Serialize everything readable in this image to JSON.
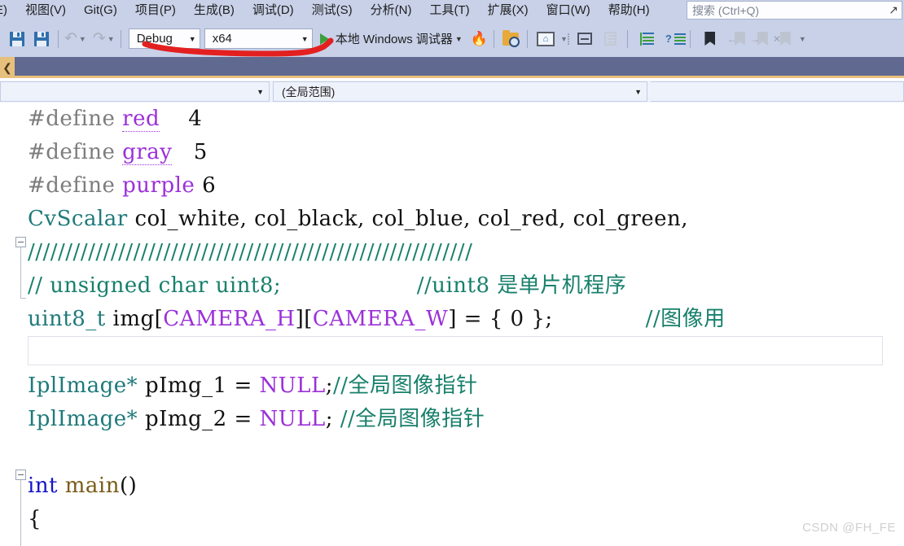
{
  "app": {
    "theme_accent": "#c8d1e8",
    "tabstrip_color": "#60698f",
    "tab_accent": "#e8c07d"
  },
  "menubar": {
    "items": [
      {
        "label": "E)",
        "name": "menu-edit-partial"
      },
      {
        "label": "视图(V)",
        "name": "menu-view"
      },
      {
        "label": "Git(G)",
        "name": "menu-git"
      },
      {
        "label": "项目(P)",
        "name": "menu-project"
      },
      {
        "label": "生成(B)",
        "name": "menu-build"
      },
      {
        "label": "调试(D)",
        "name": "menu-debug"
      },
      {
        "label": "测试(S)",
        "name": "menu-test"
      },
      {
        "label": "分析(N)",
        "name": "menu-analyze"
      },
      {
        "label": "工具(T)",
        "name": "menu-tools"
      },
      {
        "label": "扩展(X)",
        "name": "menu-extensions"
      },
      {
        "label": "窗口(W)",
        "name": "menu-window"
      },
      {
        "label": "帮助(H)",
        "name": "menu-help"
      }
    ],
    "search": {
      "placeholder": "搜索 (Ctrl+Q)",
      "arrow": "↗"
    }
  },
  "toolbar": {
    "config": {
      "value": "Debug",
      "caret": "▼"
    },
    "platform": {
      "value": "x64",
      "caret": "▼"
    },
    "run": {
      "label": "本地 Windows 调试器",
      "caret": "▼"
    },
    "overflow_caret": "▼"
  },
  "navbar": {
    "project_scope": {
      "value": "",
      "caret": "▼"
    },
    "member_scope": {
      "value": "(全局范围)",
      "caret": "▼"
    }
  },
  "tabstrip": {
    "left_chevron": "❮"
  },
  "code": {
    "lines": [
      {
        "id": "l1",
        "tokens": [
          {
            "t": "#define ",
            "c": "t-pre"
          },
          {
            "t": "red",
            "c": "t-macro-u"
          },
          {
            "t": "    ",
            "c": "t-plain"
          },
          {
            "t": "4",
            "c": "t-num"
          }
        ]
      },
      {
        "id": "l2",
        "tokens": [
          {
            "t": "#define ",
            "c": "t-pre"
          },
          {
            "t": "gray",
            "c": "t-macro-u"
          },
          {
            "t": "   ",
            "c": "t-plain"
          },
          {
            "t": "5",
            "c": "t-num"
          }
        ]
      },
      {
        "id": "l3",
        "tokens": [
          {
            "t": "#define ",
            "c": "t-pre"
          },
          {
            "t": "purple",
            "c": "t-macro"
          },
          {
            "t": " ",
            "c": "t-plain"
          },
          {
            "t": "6",
            "c": "t-num"
          }
        ]
      },
      {
        "id": "l4",
        "tokens": [
          {
            "t": "CvScalar",
            "c": "t-type"
          },
          {
            "t": " col_white, col_black, col_blue, col_red, col_green,",
            "c": "t-plain"
          }
        ]
      },
      {
        "id": "l5",
        "tokens": [
          {
            "t": "///////////////////////////////////////////////////////////",
            "c": "t-cmt"
          }
        ]
      },
      {
        "id": "l6",
        "tokens": [
          {
            "t": "// unsigned char uint8;",
            "c": "t-cmt"
          },
          {
            "t": "                   ",
            "c": "t-plain"
          },
          {
            "t": "//uint8 是单片机程序",
            "c": "t-cmt"
          }
        ]
      },
      {
        "id": "l7",
        "tokens": [
          {
            "t": "uint8_t",
            "c": "t-type"
          },
          {
            "t": " img[",
            "c": "t-plain"
          },
          {
            "t": "CAMERA_H",
            "c": "t-macro"
          },
          {
            "t": "][",
            "c": "t-plain"
          },
          {
            "t": "CAMERA_W",
            "c": "t-macro"
          },
          {
            "t": "] = { 0 };",
            "c": "t-plain"
          },
          {
            "t": "             ",
            "c": "t-plain"
          },
          {
            "t": "//图像用",
            "c": "t-cmt"
          }
        ]
      },
      {
        "id": "l8",
        "tokens": [
          {
            "t": " ",
            "c": "t-plain"
          }
        ]
      },
      {
        "id": "l9",
        "tokens": [
          {
            "t": "IplImage*",
            "c": "t-type"
          },
          {
            "t": " pImg_1 = ",
            "c": "t-plain"
          },
          {
            "t": "NULL",
            "c": "t-macro"
          },
          {
            "t": ";",
            "c": "t-plain"
          },
          {
            "t": "//全局图像指针",
            "c": "t-cmt"
          }
        ]
      },
      {
        "id": "l10",
        "tokens": [
          {
            "t": "IplImage*",
            "c": "t-type"
          },
          {
            "t": " pImg_2 = ",
            "c": "t-plain"
          },
          {
            "t": "NULL",
            "c": "t-macro"
          },
          {
            "t": "; ",
            "c": "t-plain"
          },
          {
            "t": "//全局图像指针",
            "c": "t-cmt"
          }
        ]
      },
      {
        "id": "l11",
        "tokens": [
          {
            "t": " ",
            "c": "t-plain"
          }
        ]
      },
      {
        "id": "l12",
        "tokens": [
          {
            "t": "int",
            "c": "t-kw"
          },
          {
            "t": " ",
            "c": "t-plain"
          },
          {
            "t": "main",
            "c": "t-fn"
          },
          {
            "t": "()",
            "c": "t-plain"
          }
        ]
      },
      {
        "id": "l13",
        "tokens": [
          {
            "t": "{",
            "c": "t-plain"
          }
        ]
      }
    ]
  },
  "watermark": {
    "text": "CSDN @FH_FE"
  }
}
